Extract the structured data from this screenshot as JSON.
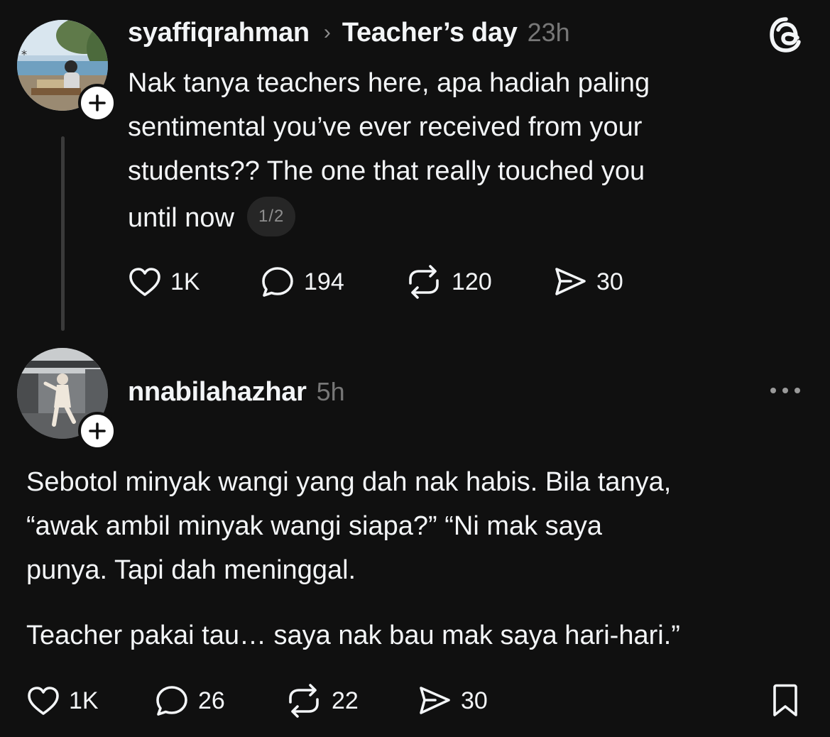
{
  "post": {
    "username": "syaffiqrahman",
    "separator": "›",
    "topic": "Teacher’s day",
    "time": "23h",
    "lines": [
      "Nak tanya teachers here, apa hadiah paling",
      "sentimental you’ve ever received from your",
      "students?? The one that really touched you",
      "until now"
    ],
    "pager": "1/2",
    "likes": "1K",
    "comments": "194",
    "reposts": "120",
    "shares": "30"
  },
  "reply": {
    "username": "nnabilahazhar",
    "time": "5h",
    "lines": [
      "Sebotol minyak wangi yang dah nak habis. Bila tanya,",
      "“awak ambil minyak wangi siapa?” “Ni mak saya",
      "punya. Tapi dah meninggal."
    ],
    "line2": "Teacher pakai tau… saya nak bau mak saya hari-hari.”",
    "likes": "1K",
    "comments": "26",
    "reposts": "22",
    "shares": "30"
  },
  "icons": {
    "app_logo": "threads-logo",
    "like": "heart-icon",
    "comment": "comment-icon",
    "repost": "repost-icon",
    "share": "share-icon",
    "more": "more-icon",
    "save": "bookmark-icon",
    "follow": "plus-icon"
  },
  "colors": {
    "background": "#101010",
    "text": "#f3f5f7",
    "muted": "#777777"
  }
}
